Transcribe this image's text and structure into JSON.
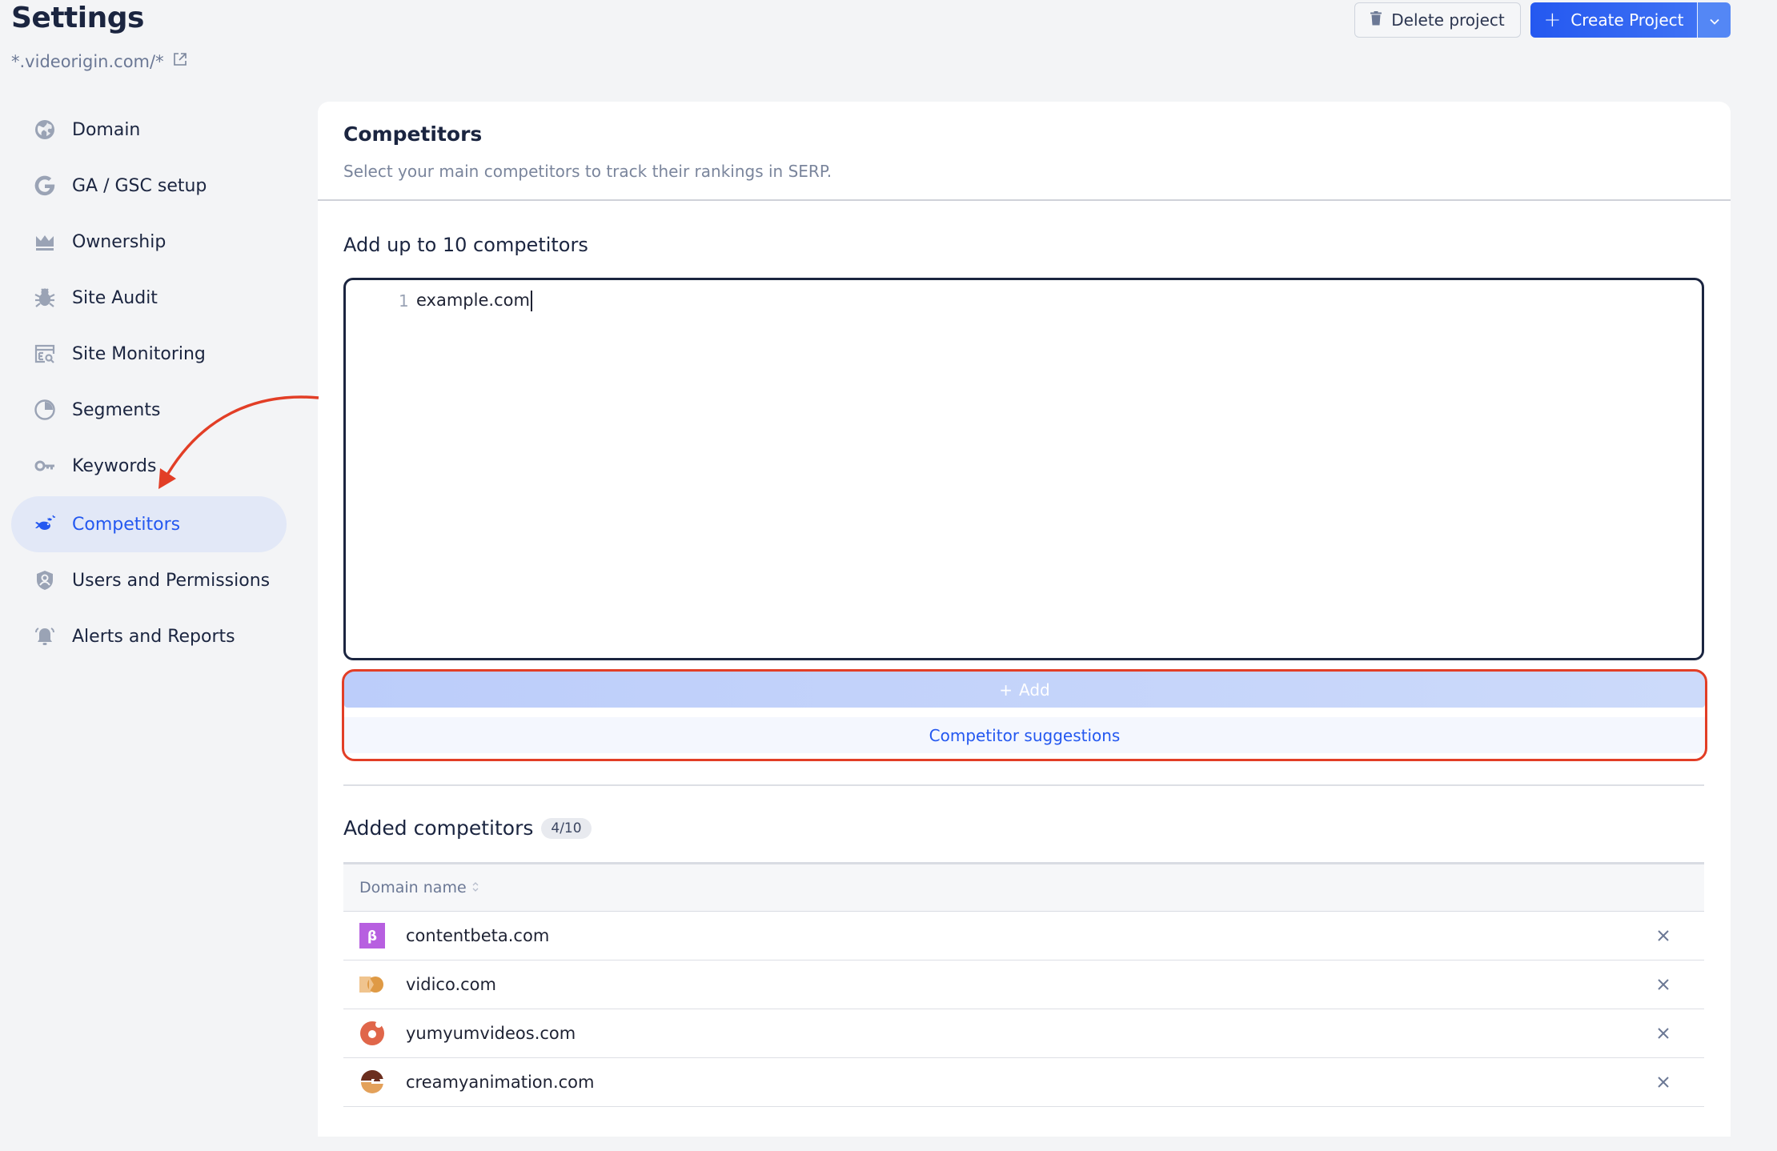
{
  "header": {
    "title": "Settings",
    "project_url": "*.videorigin.com/*",
    "delete_label": "Delete project",
    "create_label": "Create Project"
  },
  "sidebar": {
    "items": [
      {
        "label": "Domain",
        "icon": "globe-icon"
      },
      {
        "label": "GA / GSC setup",
        "icon": "google-icon"
      },
      {
        "label": "Ownership",
        "icon": "crown-icon"
      },
      {
        "label": "Site Audit",
        "icon": "bug-icon"
      },
      {
        "label": "Site Monitoring",
        "icon": "monitor-search-icon"
      },
      {
        "label": "Segments",
        "icon": "pie-icon"
      },
      {
        "label": "Keywords",
        "icon": "key-icon"
      },
      {
        "label": "Competitors",
        "icon": "fish-icon",
        "active": true
      },
      {
        "label": "Users and Permissions",
        "icon": "user-shield-icon"
      },
      {
        "label": "Alerts and Reports",
        "icon": "bell-icon"
      }
    ]
  },
  "main": {
    "title": "Competitors",
    "subtitle": "Select your main competitors to track their rankings in SERP.",
    "add_label": "Add up to 10 competitors",
    "editor": {
      "line_number": "1",
      "value": "example.com"
    },
    "add_button": "Add",
    "suggestions_button": "Competitor suggestions",
    "added_title": "Added competitors",
    "added_count": "4/10",
    "table": {
      "column": "Domain name",
      "rows": [
        {
          "domain": "contentbeta.com",
          "favicon": "beta-icon"
        },
        {
          "domain": "vidico.com",
          "favicon": "vidico-icon"
        },
        {
          "domain": "yumyumvideos.com",
          "favicon": "donut-icon"
        },
        {
          "domain": "creamyanimation.com",
          "favicon": "creamy-icon"
        }
      ]
    }
  },
  "colors": {
    "accent": "#2458f0",
    "annotation": "#e23e26",
    "text": "#1b2540"
  }
}
